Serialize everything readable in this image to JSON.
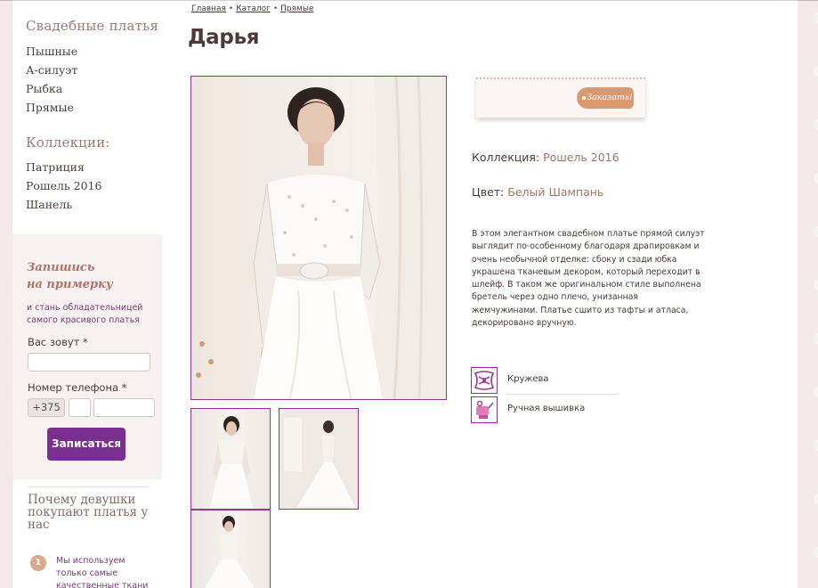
{
  "sidebar": {
    "dresses_heading": "Свадебные платья",
    "dress_links": [
      "Пышные",
      "А-силуэт",
      "Рыбка",
      "Прямые"
    ],
    "collections_heading": "Коллекции:",
    "collection_links": [
      "Патриция",
      "Рошель 2016",
      "Шанель"
    ]
  },
  "signup": {
    "title_line1": "Запишись",
    "title_line2": "на примерку",
    "subtitle": "и стань обладательницей самого красивого платья",
    "name_label": "Вас зовут *",
    "phone_label": "Номер телефона *",
    "phone_prefix": "+375",
    "submit_label": "Записаться"
  },
  "why": {
    "title": "Почему девушки покупают платья у нас",
    "reasons": [
      {
        "num": "1",
        "text": "Мы используем только самые качественные ткани"
      }
    ]
  },
  "breadcrumb": [
    "Главная",
    "Каталог",
    "Прямые"
  ],
  "product": {
    "title": "Дарья",
    "order_label": "Заказать!",
    "collection_label": "Коллекция:",
    "collection_value": "Рошель 2016",
    "color_label": "Цвет:",
    "color_value": "Белый Шампань",
    "description": "В этом элегантном свадебном платье прямой силуэт выглядит по-особенному благодаря драпировкам и очень необычной отделке: сбоку и сзади юбка украшена тканевым декором, который переходит в шлейф. В таком же оригинальном стиле выполнена бретель через одно плечо, унизанная жемчужинами. Платье сшито из тафты и атласа, декорировано вручную.",
    "features": [
      {
        "icon": "lace-icon",
        "label": "Кружева"
      },
      {
        "icon": "embroidery-icon",
        "label": "Ручная вышивка"
      }
    ]
  },
  "colors": {
    "accent_purple": "#7a2f8f",
    "heading_brown": "#a07a72",
    "order_tag": "#d99a70",
    "page_bg": "#f3e9ea"
  }
}
